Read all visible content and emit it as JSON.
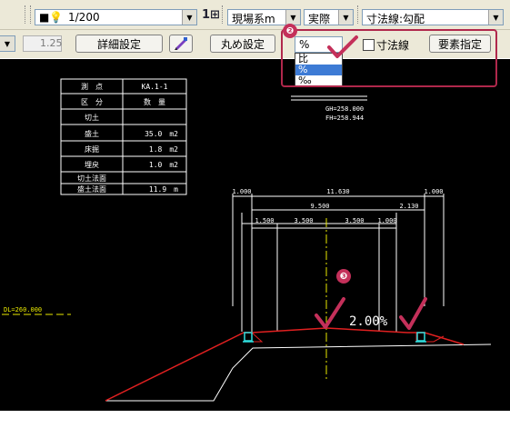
{
  "toolbar1": {
    "color_swatch_label": "■",
    "scale_value": "1/200",
    "insert_icon_label": "1⊞",
    "coordinate_system": "現場系m",
    "actual_label": "実際",
    "dimension_line_type": "寸法線:勾配"
  },
  "toolbar2": {
    "value_field": "1.25",
    "detail_button": "詳細設定",
    "round_button": "丸め設定",
    "unit_combo_value": "%",
    "dimension_checkbox_label": "寸法線",
    "element_button": "要素指定"
  },
  "unit_dropdown": {
    "options": [
      "比",
      "%",
      "‰"
    ],
    "selected_index": 1
  },
  "annotations": {
    "step2": "❷",
    "step3": "❸"
  },
  "table": {
    "header_point": "測　点",
    "header_point_value": "KA.1-1",
    "header_class": "区　分",
    "header_qty": "数　量",
    "rows": [
      {
        "label": "切土",
        "value": ""
      },
      {
        "label": "盛土",
        "value": "35.0　m2"
      },
      {
        "label": "床掘",
        "value": "1.8　m2"
      },
      {
        "label": "埋戻",
        "value": "1.0　m2"
      },
      {
        "label": "切土法面",
        "value": ""
      },
      {
        "label": "盛土法面",
        "value": "11.9　m"
      }
    ]
  },
  "cad": {
    "gh": "GH=258.000",
    "fh": "FH=258.944",
    "dl": "DL=260.000",
    "slope": "2.00%",
    "dims_top": [
      "1.000",
      "11.630",
      "1.000"
    ],
    "dims_mid": [
      "9.500",
      "2.130"
    ],
    "dims_low": [
      "1.500",
      "3.500",
      "3.500",
      "1.000"
    ]
  },
  "colors": {
    "accent": "#b0284c",
    "road_line": "#e02020",
    "center_line": "#e8e800",
    "selected_item": "#3d7bd5"
  }
}
